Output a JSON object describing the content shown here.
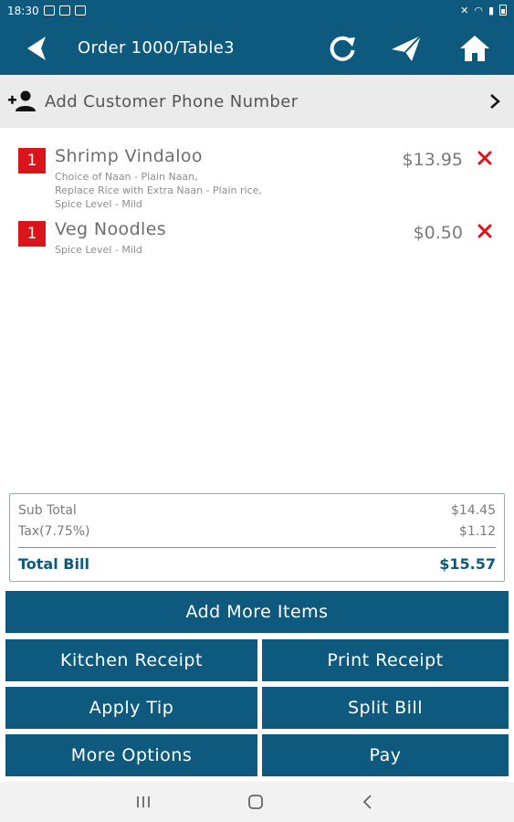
{
  "status_bar": {
    "time": "18:30"
  },
  "app_bar": {
    "title": "Order 1000/Table3"
  },
  "customer": {
    "label": "Add Customer Phone Number"
  },
  "orders": [
    {
      "qty": "1",
      "name": "Shrimp Vindaloo",
      "modifiers": [
        "Choice of Naan - Plain Naan,",
        "Replace Rice with Extra Naan - Plain rice,",
        "Spice Level - Mild"
      ],
      "price": "$13.95"
    },
    {
      "qty": "1",
      "name": "Veg Noodles",
      "modifiers": [
        "Spice Level - Mild"
      ],
      "price": "$0.50"
    }
  ],
  "totals": {
    "sub_total_label": "Sub Total",
    "sub_total_value": "$14.45",
    "tax_label": "Tax(7.75%)",
    "tax_value": "$1.12",
    "total_label": "Total Bill",
    "total_value": "$15.57"
  },
  "buttons": {
    "add_more": "Add More Items",
    "kitchen_receipt": "Kitchen Receipt",
    "print_receipt": "Print Receipt",
    "apply_tip": "Apply Tip",
    "split_bill": "Split Bill",
    "more_options": "More Options",
    "pay": "Pay"
  },
  "colors": {
    "primary": "#0e5a7e",
    "accent": "#d9141b",
    "remove": "#e0131b",
    "customer_bar": "#ebebeb"
  },
  "icons": [
    "back-arrow-icon",
    "refresh-icon",
    "send-icon",
    "home-icon",
    "add-person-icon",
    "chevron-right-icon",
    "remove-icon",
    "recents-icon",
    "home-button-icon",
    "back-nav-icon"
  ]
}
